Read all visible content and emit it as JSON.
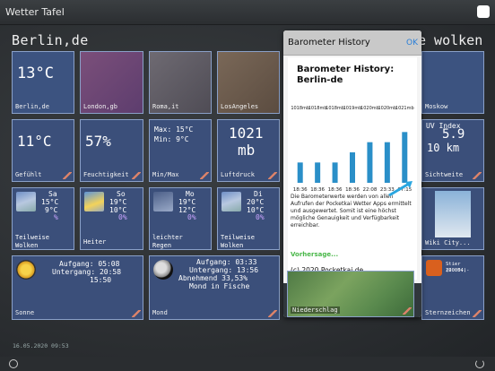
{
  "app_title": "Wetter Tafel",
  "city_left": "Berlin,de",
  "city_right": "e wolken",
  "timestamp": "16.05.2020 09:53",
  "tiles": {
    "berlin": {
      "value": "13°C",
      "label": "Berlin,de"
    },
    "london": {
      "label": "London,gb"
    },
    "roma": {
      "label": "Roma,it"
    },
    "la": {
      "label": "LosAngeles"
    },
    "moscow": {
      "label": "Moskow"
    },
    "gefuehlt": {
      "value": "11°C",
      "label": "Gefühlt"
    },
    "feuchtigkeit": {
      "value": "57%",
      "label": "Feuchtigkeit"
    },
    "minmax": {
      "line1": "Max: 15°C",
      "line2": "Min: 9°C",
      "label": "Min/Max"
    },
    "luftdruck": {
      "value": "1021",
      "unit": "mb",
      "label": "Luftdruck"
    },
    "sicht": {
      "line1": "UV Index",
      "value": "5.9",
      "value2": "10 km",
      "label": "Sichtweite"
    },
    "fc1": {
      "day": "Sa",
      "t1": "15°C",
      "t2": "9°C",
      "p": "%",
      "label1": "Teilweise",
      "label2": "Wolken"
    },
    "fc2": {
      "day": "So",
      "t1": "19°C",
      "t2": "10°C",
      "p": "0%",
      "label1": "Heiter",
      "label2": ""
    },
    "fc3": {
      "day": "Mo",
      "t1": "19°C",
      "t2": "12°C",
      "p": "0%",
      "label1": "leichter",
      "label2": "Regen"
    },
    "fc4": {
      "day": "Di",
      "t1": "20°C",
      "t2": "10°C",
      "p": "0%",
      "label1": "Teilweise",
      "label2": "Wolken"
    },
    "wiki": {
      "label": "Wiki City..."
    },
    "sonne": {
      "l1": "Aufgang: 05:08",
      "l2": "Untergang: 20:58",
      "l3": "15:50",
      "label": "Sonne"
    },
    "mond": {
      "l1": "Aufgang: 03:33",
      "l2": "Untergang: 13:56",
      "l3": "Abnehmend 33,53%",
      "l4": "Mond in Fische",
      "label": "Mond"
    },
    "niederschlag": {
      "label": "Niederschlag"
    },
    "sternzeichen": {
      "l1": "Stier (20.04.-",
      "l2": "20.05.)",
      "label": "Sternzeichen"
    }
  },
  "popover": {
    "header": "Barometer History",
    "ok": "OK",
    "title1": "Barometer History:",
    "title2": "Berlin-de",
    "text": "Die Barometerwerte werden von allen Aufrufen der Pocketkai Wetter Apps ermittelt und ausgewertet. Somit ist eine höchst mögliche Genauigkeit und Verfügbarkeit erreichbar.",
    "more": "Vorhersage...",
    "copyright": "(c) 2020 Pocketkai.de"
  },
  "chart_data": {
    "type": "bar",
    "categories": [
      "18:36",
      "18:36",
      "18:36",
      "18:36",
      "22:08",
      "23:33",
      "07:15"
    ],
    "top_labels": [
      "1018mb",
      "1018mb",
      "1018mb",
      "1019mb",
      "1020mb",
      "1020mb",
      "1021mb"
    ],
    "values": [
      1018,
      1018,
      1018,
      1019,
      1020,
      1020,
      1021
    ],
    "ylim": [
      1016,
      1022
    ]
  }
}
